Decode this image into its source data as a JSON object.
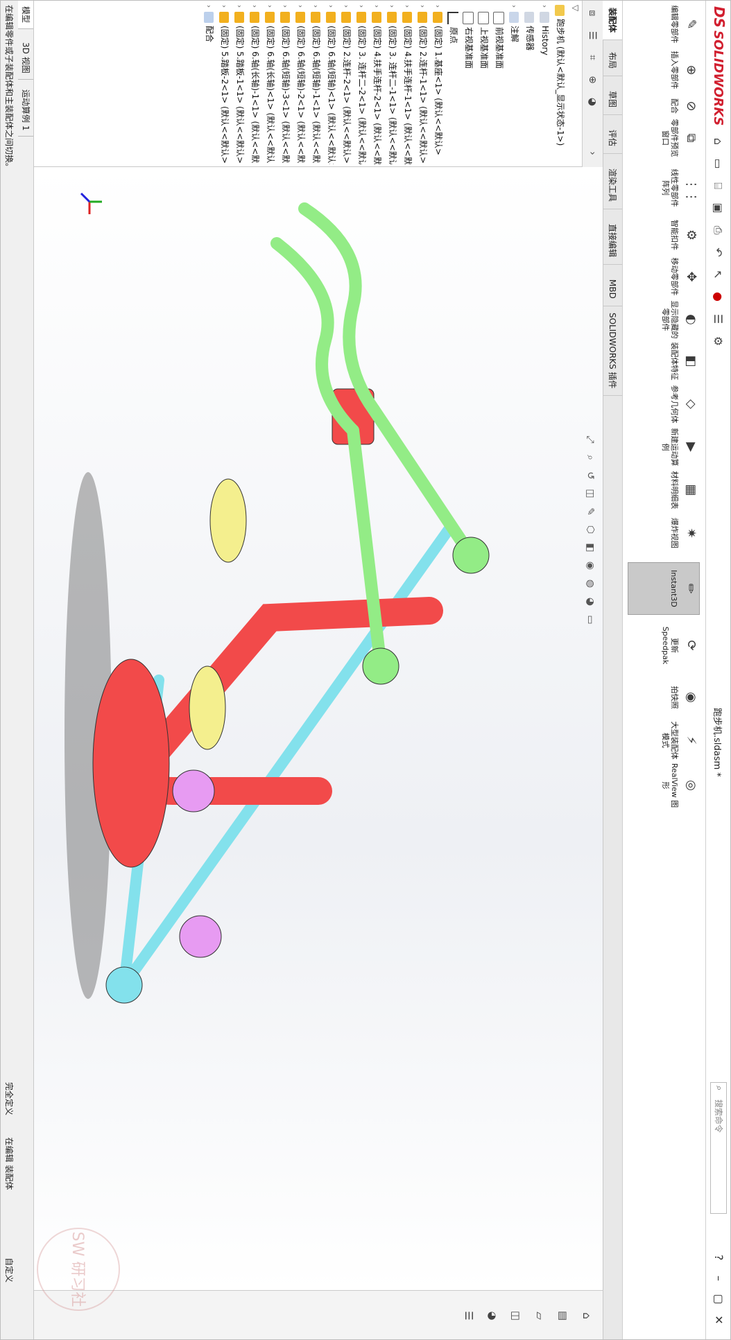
{
  "titlebar": {
    "brand_prefix": "DS",
    "brand": "SOLIDWORKS",
    "document_title": "跑步机.sldasm *",
    "search_placeholder": "搜索命令"
  },
  "ribbon": {
    "buttons": [
      {
        "label": "编辑零部件",
        "icon": "edit-component-icon"
      },
      {
        "label": "插入零部件",
        "icon": "insert-component-icon"
      },
      {
        "label": "配合",
        "icon": "mate-icon"
      },
      {
        "label": "零部件预览窗口",
        "icon": "preview-window-icon"
      },
      {
        "label": "线性零部件阵列",
        "icon": "linear-pattern-icon"
      },
      {
        "label": "智能扣件",
        "icon": "smart-fastener-icon"
      },
      {
        "label": "移动零部件",
        "icon": "move-component-icon"
      },
      {
        "label": "显示隐藏的零部件",
        "icon": "show-hidden-icon"
      },
      {
        "label": "装配体特征",
        "icon": "assembly-feature-icon"
      },
      {
        "label": "参考几何体",
        "icon": "reference-geometry-icon"
      },
      {
        "label": "新建运动算例",
        "icon": "motion-study-icon"
      },
      {
        "label": "材料明细表",
        "icon": "bom-icon"
      },
      {
        "label": "爆炸视图",
        "icon": "exploded-view-icon"
      },
      {
        "label": "Instant3D",
        "icon": "instant3d-icon"
      },
      {
        "label": "更新 Speedpak",
        "icon": "speedpak-icon"
      },
      {
        "label": "拍快照",
        "icon": "snapshot-icon"
      },
      {
        "label": "大型装配体模式",
        "icon": "large-assembly-icon"
      },
      {
        "label": "RealView 图形",
        "icon": "realview-icon"
      }
    ]
  },
  "tabs": [
    "装配体",
    "布局",
    "草图",
    "评估",
    "渲染工具",
    "直接编辑",
    "MBD",
    "SOLIDWORKS 插件"
  ],
  "tree": {
    "root": "跑步机 (默认<默认_显示状态-1>)",
    "items": [
      "History",
      "传感器",
      "注解",
      "前视基准面",
      "上视基准面",
      "右视基准面",
      "原点",
      "(固定) 1.基座<1> (默认<<默认>",
      "(固定) 2.连杆-1<1> (默认<<默认>",
      "(固定) 4.扶手连杆-1<1> (默认<<默",
      "(固定) 3. 连杆二-1<1> (默认<<默认",
      "(固定) 4.扶手连杆-2<1> (默认<<默",
      "(固定) 3. 连杆二-2<1> (默认<<默认",
      "(固定) 2.连杆-2<1> (默认<<默认>",
      "(固定) 6.轴(短轴)<1> (默认<<默认>",
      "(固定) 6.轴(短轴)-1<1> (默认<<默",
      "(固定) 6.轴(短轴)-2<1> (默认<<默",
      "(固定) 6.轴(短轴)-3<1> (默认<<默",
      "(固定) 6.轴(长轴)<1> (默认<<默认",
      "(固定) 6.轴(长轴)-1<1> (默认<<默",
      "(固定) 5.踏板-1<1> (默认<<默认>",
      "(固定) 5.踏板-2<1> (默认<<默认>",
      "配合"
    ]
  },
  "bottom_tabs": [
    "模型",
    "3D 视图",
    "运动算例 1"
  ],
  "status": {
    "message": "在编辑零件或子装配体和主装配体之间切换。",
    "state": "完全定义",
    "mode": "在编辑 装配体",
    "units": "自定义"
  },
  "watermark": "SW 研习社"
}
